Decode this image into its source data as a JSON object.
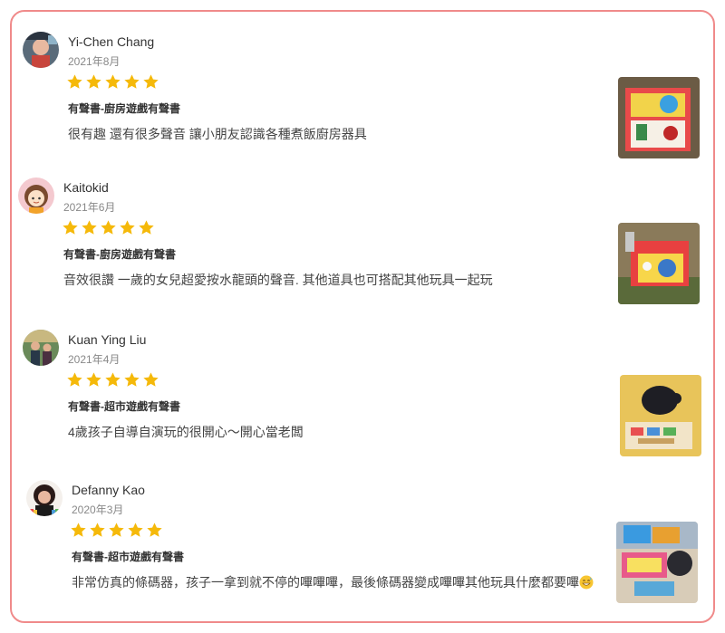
{
  "colors": {
    "star": "#f5b90a",
    "border": "#f08a8a"
  },
  "reviews": [
    {
      "name": "Yi-Chen Chang",
      "date": "2021年8月",
      "rating": 5,
      "variant": "有聲書-廚房遊戲有聲書",
      "text": "很有趣 還有很多聲音 讓小朋友認識各種煮飯廚房器具",
      "avatar_icon": "child-avatar-icon",
      "photo": "book-photo"
    },
    {
      "name": "Kaitokid",
      "date": "2021年6月",
      "rating": 5,
      "variant": "有聲書-廚房遊戲有聲書",
      "text": "音效很讚 一歲的女兒超愛按水龍頭的聲音. 其他道具也可搭配其他玩具一起玩",
      "avatar_icon": "cartoon-girl-avatar-icon",
      "photo": "toy-photo"
    },
    {
      "name": "Kuan Ying Liu",
      "date": "2021年4月",
      "rating": 5,
      "variant": "有聲書-超市遊戲有聲書",
      "text": "4歲孩子自導自演玩的很開心～開心當老闆",
      "avatar_icon": "family-avatar-icon",
      "photo": "child-playing-photo"
    },
    {
      "name": "Defanny Kao",
      "date": "2020年3月",
      "rating": 5,
      "variant": "有聲書-超市遊戲有聲書",
      "text": "非常仿真的條碼器，孩子一拿到就不停的嗶嗶嗶，最後條碼器變成嗶嗶其他玩具什麼都要嗶",
      "emoji": "grinning-sweat-emoji-icon",
      "avatar_icon": "woman-avatar-icon",
      "photo": "toddler-photo"
    }
  ]
}
